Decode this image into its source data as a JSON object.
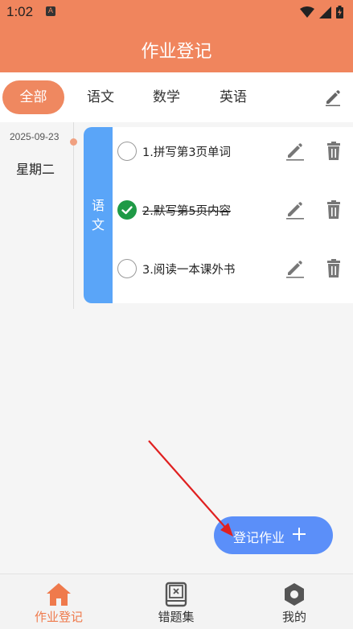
{
  "status_bar": {
    "time": "1:02",
    "notification_icon": "android-a-icon",
    "icons": [
      "wifi-icon",
      "signal-icon",
      "battery-icon"
    ]
  },
  "app_bar": {
    "title": "作业登记"
  },
  "tabs": {
    "items": [
      {
        "label": "全部",
        "active": true
      },
      {
        "label": "语文",
        "active": false
      },
      {
        "label": "数学",
        "active": false
      },
      {
        "label": "英语",
        "active": false
      }
    ],
    "edit_icon": "pencil-icon"
  },
  "day": {
    "date": "2025-09-23",
    "weekday": "星期二"
  },
  "subject_card": {
    "subject": "语文",
    "subject_color": "#5aa5f8",
    "tasks": [
      {
        "text": "1.拼写第3页单词",
        "done": false
      },
      {
        "text": "2.默写第5页内容",
        "done": true
      },
      {
        "text": "3.阅读一本课外书",
        "done": false
      }
    ]
  },
  "fab": {
    "label": "登记作业",
    "icon": "plus-icon",
    "color": "#5b8ff9"
  },
  "bottom_nav": {
    "items": [
      {
        "label": "作业登记",
        "icon": "home-icon",
        "active": true
      },
      {
        "label": "错题集",
        "icon": "book-icon",
        "active": false
      },
      {
        "label": "我的",
        "icon": "hexagon-icon",
        "active": false
      }
    ]
  },
  "colors": {
    "accent": "#f0855d",
    "done_green": "#1f9a46",
    "annotation_arrow": "#e02020"
  }
}
